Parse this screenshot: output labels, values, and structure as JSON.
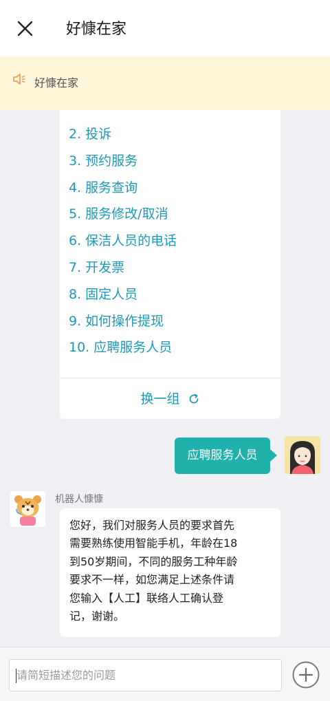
{
  "header": {
    "title": "好慷在家"
  },
  "notice": {
    "text": "好慷在家"
  },
  "menu": {
    "items": [
      "2. 投诉",
      "3. 预约服务",
      "4. 服务查询",
      "5. 服务修改/取消",
      "6. 保洁人员的电话",
      "7. 开发票",
      "8. 固定人员",
      "9. 如何操作提现",
      "10. 应聘服务人员"
    ],
    "refresh_label": "换一组"
  },
  "user_message": {
    "text": "应聘服务人员"
  },
  "bot": {
    "name": "机器人慷慷",
    "message_lines": [
      "您好，我们对服务人员的要求首先",
      "需要熟练使用智能手机，年龄在18",
      "到50岁期间，不同的服务工种年龄",
      "要求不一样，如您满足上述条件请",
      "您输入【人工】联络人工确认登",
      "记，谢谢。"
    ]
  },
  "input": {
    "placeholder": "请简短描述您的问题"
  },
  "colors": {
    "accent": "#1e9ab8",
    "bubble": "#21b1ac",
    "notice_bg": "#fdf6d8"
  }
}
